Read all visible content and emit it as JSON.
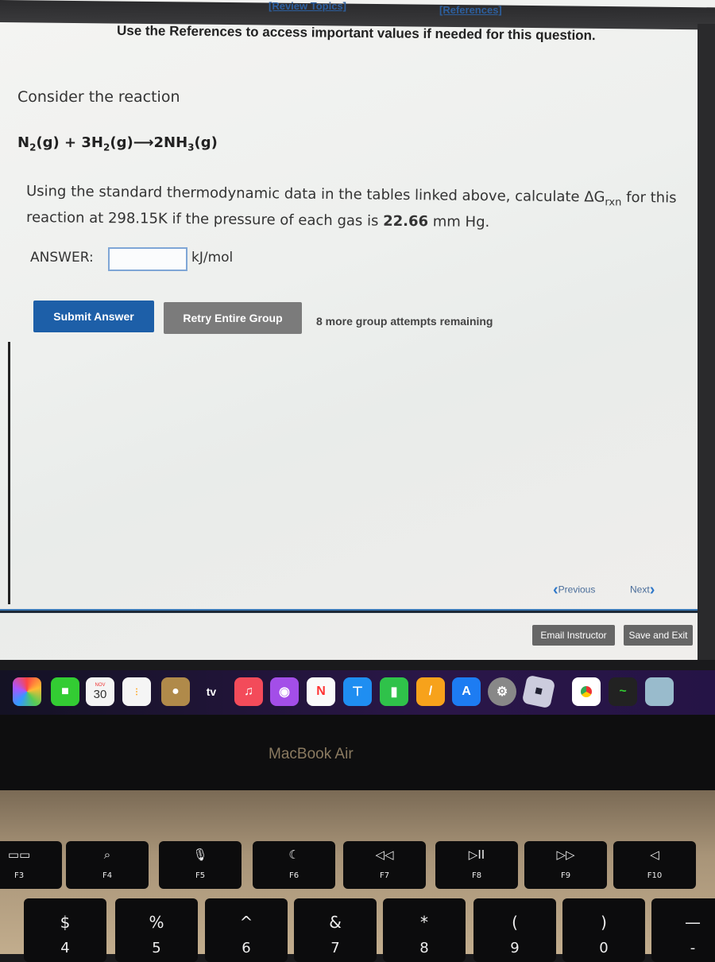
{
  "header": {
    "review_topics": "[Review Topics]",
    "references": "[References]",
    "note": "Use the References to access important values if needed for this question."
  },
  "question": {
    "intro": "Consider the reaction",
    "equation": {
      "n2": "N",
      "n2_sub": "2",
      "n2_state": "(g) + 3H",
      "h2_sub": "2",
      "h2_state": "(g)",
      "arrow": "⟶",
      "nh3": "2NH",
      "nh3_sub": "3",
      "nh3_state": "(g)"
    },
    "line1_a": "Using the standard thermodynamic data in the tables linked above, calculate ΔG",
    "line1_sub": "rxn",
    "line1_b": " for this",
    "line2_a": "reaction at 298.15K if the pressure of each gas is ",
    "pressure": "22.66",
    "line2_b": " mm Hg."
  },
  "answer": {
    "label": "ANSWER:",
    "value": "",
    "unit": "kJ/mol"
  },
  "actions": {
    "submit": "Submit Answer",
    "retry": "Retry Entire Group",
    "attempts": "8 more group attempts remaining"
  },
  "nav": {
    "previous": "Previous",
    "next": "Next",
    "email": "Email Instructor",
    "save_exit": "Save and Exit"
  },
  "dock": {
    "calendar_month": "NOV",
    "calendar_day": "30",
    "tv": "tv",
    "apps": [
      "photos-icon",
      "facetime-icon",
      "calendar-icon",
      "reminders-icon",
      "contacts-icon",
      "apple-tv-icon",
      "music-icon",
      "podcasts-icon",
      "news-icon",
      "keynote-icon",
      "numbers-icon",
      "pages-icon",
      "app-store-icon",
      "system-settings-icon",
      "roblox-icon",
      "chrome-icon",
      "activity-monitor-icon",
      "preview-icon"
    ]
  },
  "laptop": {
    "model": "MacBook Air"
  },
  "keyboard": {
    "fkeys": [
      {
        "glyph": "▭▭",
        "label": "F3"
      },
      {
        "glyph": "⌕",
        "label": "F4"
      },
      {
        "glyph": "🎙",
        "label": "F5"
      },
      {
        "glyph": "☾",
        "label": "F6"
      },
      {
        "glyph": "◁◁",
        "label": "F7"
      },
      {
        "glyph": "▷II",
        "label": "F8"
      },
      {
        "glyph": "▷▷",
        "label": "F9"
      },
      {
        "glyph": "◁",
        "label": "F10"
      }
    ],
    "numkeys": [
      {
        "glyph": "$",
        "label": "4"
      },
      {
        "glyph": "%",
        "label": "5"
      },
      {
        "glyph": "^",
        "label": "6"
      },
      {
        "glyph": "&",
        "label": "7"
      },
      {
        "glyph": "*",
        "label": "8"
      },
      {
        "glyph": "(",
        "label": "9"
      },
      {
        "glyph": ")",
        "label": "0"
      },
      {
        "glyph": "—",
        "label": "-"
      }
    ]
  }
}
